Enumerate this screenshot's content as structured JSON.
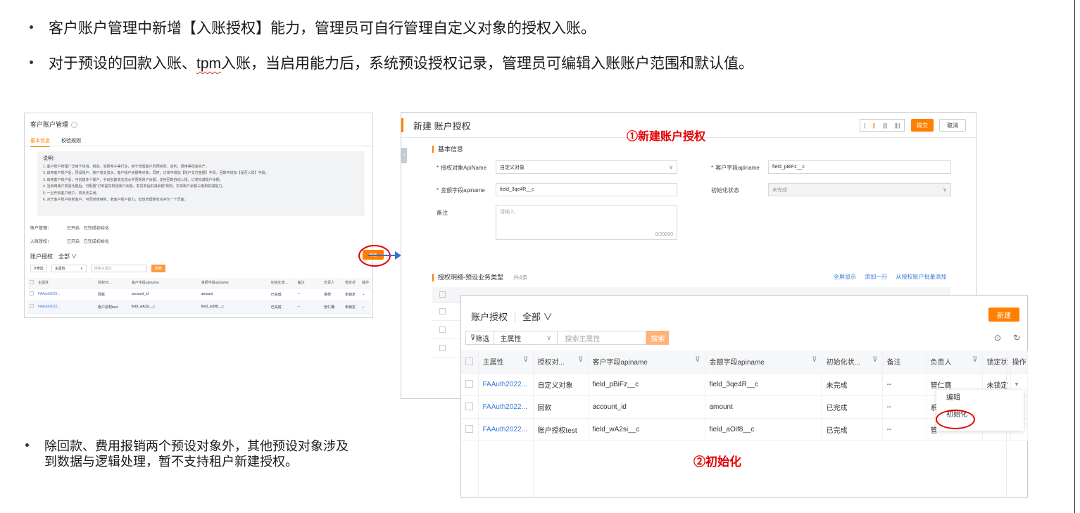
{
  "bullets": {
    "b1": "客户账户管理中新增【入账授权】能力，管理员可自行管理自定义对象的授权入账。",
    "b2_pre": "对于预设的回款入账、",
    "b2_tpm": "tpm",
    "b2_post": "入账，当启用能力后，系统预设授权记录，管理员可编辑入账账户范围和默认值。",
    "b3_l1": "除回款、费用报销两个预设对象外，其他预设对象涉及",
    "b3_l2": "到数据与逻辑处理，暂不支持租户新建授权。"
  },
  "panel1": {
    "title": "客户账户管理",
    "tabs": [
      "基本信息",
      "校验规则"
    ],
    "desc_title": "说明：",
    "desc_lines": [
      "1. 客户账户管理广泛用于快消、制造、消费电子等行业，用于管理客户的预存款、返利、费用等现金资产。",
      "2. 启用客户账户后，预设账户、账户收支流水、客户账户余额等对象。同时，订单中增加【账户支付金额】字段，回款中增加【是否入账】字段。",
      "3. 启用客户账户后，可创建多个账户，手动创建收支流水并更新账户余额。支持回款自动入账、订单扣减账户余额。",
      "4. 当启用账户校验功能后，可配置\"订单提交校验账户余额，发货单后扣减余额\"规则，实现账户余额占用和扣减能力。",
      "5. 一旦开启客户账户，将无法关闭。",
      "6. 对于客户账户的老客户，可同时使用新、老客户账户能力，但该管理菜单合并为一个页面。"
    ],
    "rows": [
      {
        "label": "账户管理：",
        "status1": "已开启",
        "status2": "已完成初始化"
      },
      {
        "label": "入账授权：",
        "status1": "已开启",
        "status2": "已完成初始化"
      }
    ],
    "section_title": "账户授权",
    "section_scope": "全部",
    "new_button": "新建",
    "filter_button": "筛选",
    "filter_field": "主属性",
    "search_placeholder": "搜索主属性",
    "search_button": "搜索",
    "headers": [
      "主属性",
      "授权对...",
      "客户字段apiname",
      "金额字段apiname",
      "初始化状...",
      "备注",
      "负责人",
      "锁定状",
      "操作"
    ],
    "rows_data": [
      [
        "FAAuth2022...",
        "回款",
        "account_id",
        "amount",
        "已完成",
        "--",
        "系统",
        "未锁定"
      ],
      [
        "FAAuth2022...",
        "账户授权test",
        "field_wA2si__c",
        "field_aOif8__c",
        "已完成",
        "--",
        "管仁膺",
        "未锁定"
      ]
    ]
  },
  "panel2": {
    "title": "新建 账户授权",
    "annotation": "①新建账户授权",
    "submit": "提交",
    "cancel": "取消",
    "section_basic": "基本信息",
    "f_obj_label": "授权对象ApiName",
    "f_obj_value": "自定义对象",
    "f_cust_label": "客户字段apiname",
    "f_cust_value": "field_pBiFz__c",
    "f_amt_label": "金额字段apiname",
    "f_amt_value": "field_3qe4R__c",
    "f_init_label": "初始化状态",
    "f_init_value": "未完成",
    "f_note_label": "备注",
    "f_note_placeholder": "请输入",
    "f_note_count": "0/20000",
    "section_detail": "授权明细-预设业务类型",
    "detail_count": "共4条",
    "link_full": "全屏显示",
    "link_add": "添加一行",
    "link_batch": "从授权账户批量添加"
  },
  "panel3": {
    "title": "账户授权",
    "scope": "全部",
    "new_button": "新建",
    "filter_button": "筛选",
    "filter_field": "主属性",
    "search_placeholder": "搜索主属性",
    "search_button": "搜索",
    "headers": [
      "主属性",
      "授权对...",
      "客户字段apiname",
      "金额字段apiname",
      "初始化状...",
      "备注",
      "负责人",
      "锁定状",
      "操作"
    ],
    "rows_data": [
      [
        "FAAuth2022...",
        "自定义对象",
        "field_pBiFz__c",
        "field_3qe4R__c",
        "未完成",
        "--",
        "管仁膺",
        "未锁定"
      ],
      [
        "FAAuth2022...",
        "回款",
        "account_id",
        "amount",
        "已完成",
        "--",
        "系",
        ""
      ],
      [
        "FAAuth2022...",
        "账户授权test",
        "field_wA2si__c",
        "field_aOif8__c",
        "已完成",
        "--",
        "管",
        ""
      ]
    ],
    "menu": [
      "编辑",
      "初始化"
    ],
    "annotation": "②初始化"
  }
}
